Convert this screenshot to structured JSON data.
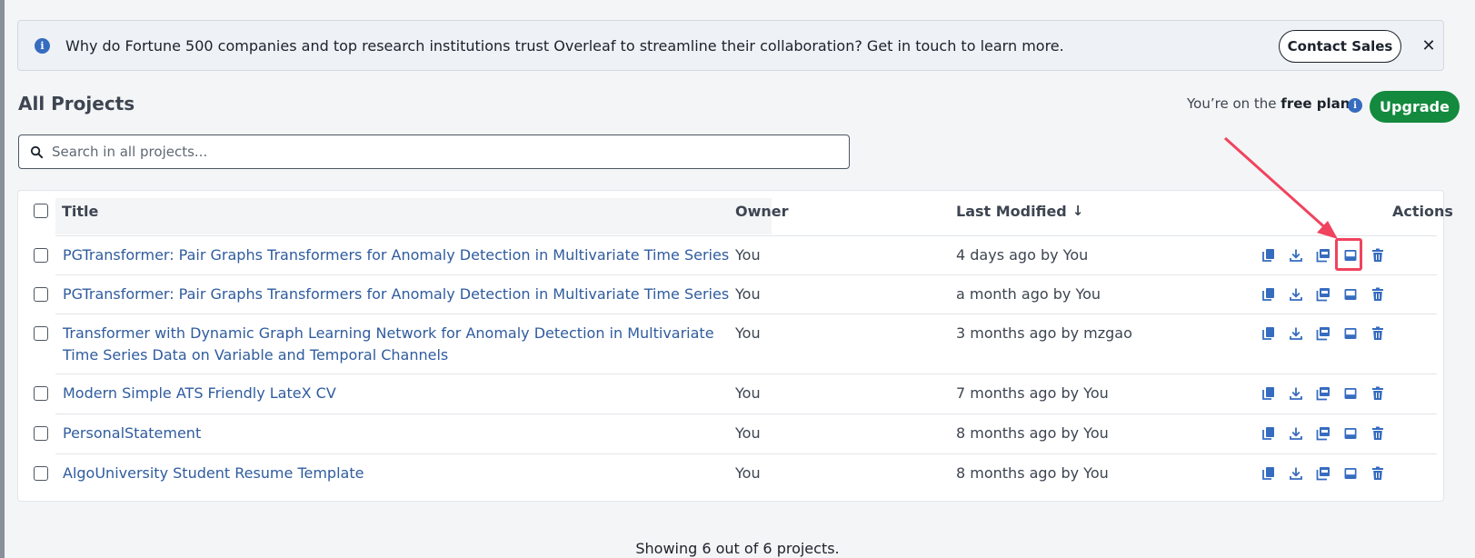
{
  "banner": {
    "message": "Why do Fortune 500 companies and top research institutions trust Overleaf to streamline their collaboration? Get in touch to learn more.",
    "contact_label": "Contact Sales",
    "close_label": "✕"
  },
  "header": {
    "title": "All Projects",
    "plan_prefix": "You’re on the ",
    "plan_name": "free plan",
    "upgrade_label": "Upgrade"
  },
  "search": {
    "placeholder": "Search in all projects..."
  },
  "table": {
    "columns": {
      "title": "Title",
      "owner": "Owner",
      "last_modified": "Last Modified",
      "sort_indicator": "↓",
      "actions": "Actions"
    },
    "rows": [
      {
        "title": "PGTransformer: Pair Graphs Transformers for Anomaly Detection in Multivariate Time Series",
        "owner": "You",
        "modified": "4 days ago by You"
      },
      {
        "title": "PGTransformer: Pair Graphs Transformers for Anomaly Detection in Multivariate Time Series",
        "owner": "You",
        "modified": "a month ago by You"
      },
      {
        "title": "Transformer with Dynamic Graph Learning Network for Anomaly Detection in Multivariate Time Series Data on Variable and Temporal Channels",
        "owner": "You",
        "modified": "3 months ago by mzgao"
      },
      {
        "title": "Modern Simple ATS Friendly LateX CV",
        "owner": "You",
        "modified": "7 months ago by You"
      },
      {
        "title": "PersonalStatement",
        "owner": "You",
        "modified": "8 months ago by You"
      },
      {
        "title": "AlgoUniversity Student Resume Template",
        "owner": "You",
        "modified": "8 months ago by You"
      }
    ],
    "action_icons": [
      "copy-icon",
      "download-icon",
      "download-pdf-icon",
      "archive-icon",
      "trash-icon"
    ]
  },
  "footer": {
    "count_text": "Showing 6 out of 6 projects."
  },
  "colors": {
    "accent": "#366cbf",
    "link": "#2f5c9e",
    "upgrade": "#138a3e",
    "annotation": "#f0435e"
  }
}
